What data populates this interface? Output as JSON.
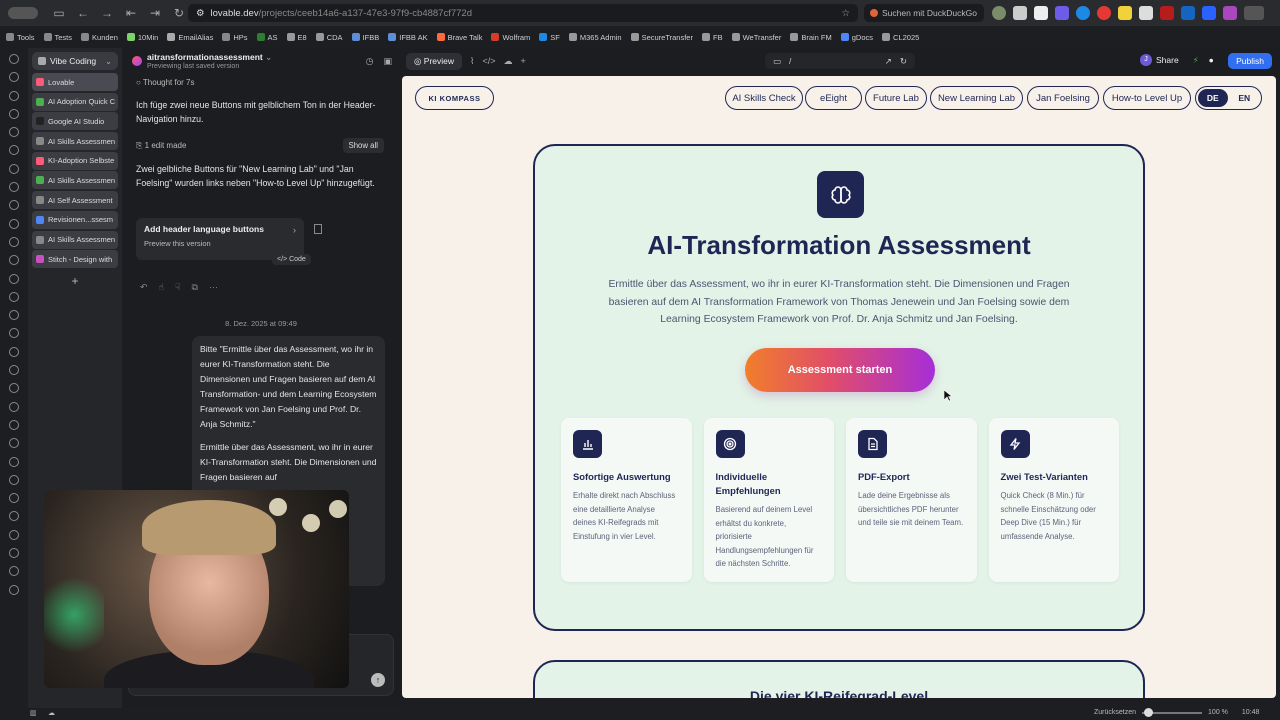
{
  "browser": {
    "url_host": "lovable.dev",
    "url_path": "/projects/ceeb14a6-a137-47e3-97f9-cb4887cf772d",
    "search_placeholder": "Suchen mit DuckDuckGo"
  },
  "bookmarks": [
    {
      "label": "Tools",
      "color": "#888"
    },
    {
      "label": "Tests",
      "color": "#888"
    },
    {
      "label": "Kunden",
      "color": "#888"
    },
    {
      "label": "10Min",
      "color": "#7bd36a"
    },
    {
      "label": "EmailAlias",
      "color": "#aaa"
    },
    {
      "label": "HPs",
      "color": "#888"
    },
    {
      "label": "AS",
      "color": "#2e7d32"
    },
    {
      "label": "E8",
      "color": "#999"
    },
    {
      "label": "CDA",
      "color": "#999"
    },
    {
      "label": "IFBB",
      "color": "#5d8fd8"
    },
    {
      "label": "IFBB AK",
      "color": "#5d8fd8"
    },
    {
      "label": "Brave Talk",
      "color": "#ff6a3d"
    },
    {
      "label": "Wolfram",
      "color": "#d43c2c"
    },
    {
      "label": "SF",
      "color": "#1e88e5"
    },
    {
      "label": "M365 Admin",
      "color": "#999"
    },
    {
      "label": "SecureTransfer",
      "color": "#999"
    },
    {
      "label": "FB",
      "color": "#999"
    },
    {
      "label": "WeTransfer",
      "color": "#999"
    },
    {
      "label": "Brain FM",
      "color": "#999"
    },
    {
      "label": "gDocs",
      "color": "#4f86f7"
    },
    {
      "label": "CL2025",
      "color": "#999"
    }
  ],
  "tabs": {
    "group_label": "Vibe Coding",
    "items": [
      {
        "label": "Lovable",
        "color": "#ff5a7a",
        "active": true
      },
      {
        "label": "AI Adoption Quick C",
        "color": "#4caf50"
      },
      {
        "label": "Google AI Studio",
        "color": "#222"
      },
      {
        "label": "AI Skills Assessmen",
        "color": "#888"
      },
      {
        "label": "KI-Adoption Selbste",
        "color": "#ff5a7a"
      },
      {
        "label": "AI Skills Assessmen",
        "color": "#4caf50"
      },
      {
        "label": "AI Self Assessment",
        "color": "#888"
      },
      {
        "label": "Revisionen...ssesm",
        "color": "#4f86f7"
      },
      {
        "label": "AI Skills Assessmen",
        "color": "#888"
      },
      {
        "label": "Stitch - Design with",
        "color": "#c850c0"
      }
    ],
    "add_label": "+"
  },
  "chat": {
    "project_title": "aitransformationassessment",
    "project_subtitle": "Previewing last saved version",
    "thought": "Thought for 7s",
    "msg1": "Ich füge zwei neue Buttons mit gelblichem Ton in der Header-Navigation hinzu.",
    "edits": "1 edit made",
    "show_all": "Show all",
    "msg2": "Zwei gelbliche Buttons für \"New Learning Lab\" und \"Jan Foelsing\" wurden links neben \"How-to Level Up\" hinzugefügt.",
    "card_title": "Add header language buttons",
    "card_sub": "Preview this version",
    "code_label": "Code",
    "date": "8. Dez. 2025 at 09:49",
    "user_p1": "Bitte \"Ermittle über das Assessment, wo ihr in eurer KI-Transformation steht. Die Dimensionen und Fragen basieren auf dem AI Transformation- und dem Learning Ecosystem Framework von Jan Foelsing und Prof. Dr. Anja Schmitz.\"",
    "user_p2": "Ermittle über das Assessment, wo ihr in eurer KI-Transformation steht. Die Dimensionen und Fragen basieren auf"
  },
  "preview_toolbar": {
    "preview_label": "Preview",
    "path": "/",
    "share_label": "Share",
    "avatar_initial": "J",
    "publish_label": "Publish"
  },
  "site": {
    "logo": "KI KOMPASS",
    "nav": [
      "AI Skills Check",
      "eEight",
      "Future Lab",
      "New Learning Lab",
      "Jan Foelsing",
      "How-to Level Up"
    ],
    "lang": {
      "de": "DE",
      "en": "EN",
      "selected": "DE"
    },
    "hero": {
      "title": "AI-Transformation Assessment",
      "description": "Ermittle über das Assessment, wo ihr in eurer KI-Transformation steht. Die Dimensionen und Fragen basieren auf dem AI Transformation Framework von Thomas Jenewein und Jan Foelsing sowie dem Learning Ecosystem Framework von Prof. Dr. Anja Schmitz und Jan Foelsing.",
      "cta": "Assessment starten"
    },
    "features": [
      {
        "icon": "bar-chart-icon",
        "title": "Sofortige Auswertung",
        "desc": "Erhalte direkt nach Abschluss eine detaillierte Analyse deines KI-Reifegrads mit Einstufung in vier Level."
      },
      {
        "icon": "target-icon",
        "title": "Individuelle Empfehlungen",
        "desc": "Basierend auf deinem Level erhältst du konkrete, priorisierte Handlungsempfehlungen für die nächsten Schritte."
      },
      {
        "icon": "document-icon",
        "title": "PDF-Export",
        "desc": "Lade deine Ergebnisse als übersichtliches PDF herunter und teile sie mit deinem Team."
      },
      {
        "icon": "lightning-icon",
        "title": "Zwei Test-Varianten",
        "desc": "Quick Check (8 Min.) für schnelle Einschätzung oder Deep Dive (15 Min.) für umfassende Analyse."
      }
    ],
    "section2_title": "Die vier KI-Reifegrad-Level"
  },
  "status": {
    "reset_label": "Zurücksetzen",
    "zoom": "100 %",
    "time": "10:48"
  }
}
